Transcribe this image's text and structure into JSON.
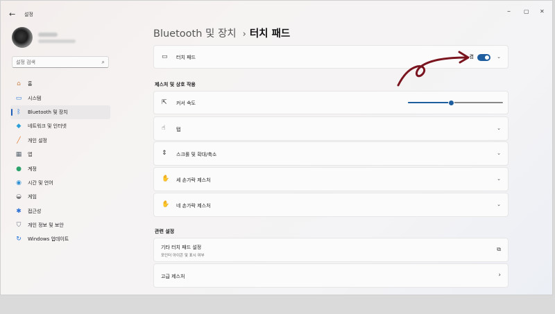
{
  "window": {
    "title": "설정",
    "back_glyph": "←",
    "minimize_glyph": "–",
    "maximize_glyph": "▢",
    "close_glyph": "✕"
  },
  "search": {
    "placeholder": "설정 검색"
  },
  "nav": {
    "items": [
      {
        "label": "홈",
        "icon": "home-icon",
        "glyph": "⌂",
        "color": "#c9864a"
      },
      {
        "label": "시스템",
        "icon": "system-icon",
        "glyph": "▭",
        "color": "#2b7cd3"
      },
      {
        "label": "Bluetooth 및 장치",
        "icon": "bluetooth-icon",
        "glyph": "ᛒ",
        "color": "#1c73d8",
        "active": true
      },
      {
        "label": "네트워크 및 인터넷",
        "icon": "wifi-icon",
        "glyph": "◆",
        "color": "#2ba0d8"
      },
      {
        "label": "개인 설정",
        "icon": "brush-icon",
        "glyph": "╱",
        "color": "#e07a2d"
      },
      {
        "label": "앱",
        "icon": "apps-icon",
        "glyph": "▦",
        "color": "#5a6772"
      },
      {
        "label": "계정",
        "icon": "account-icon",
        "glyph": "●",
        "color": "#2ba36b"
      },
      {
        "label": "시간 및 언어",
        "icon": "globe-icon",
        "glyph": "◉",
        "color": "#2b8fd3"
      },
      {
        "label": "게임",
        "icon": "gamepad-icon",
        "glyph": "◒",
        "color": "#7a7a7a"
      },
      {
        "label": "접근성",
        "icon": "accessibility-icon",
        "glyph": "✱",
        "color": "#2b6fd3"
      },
      {
        "label": "개인 정보 및 보안",
        "icon": "shield-icon",
        "glyph": "⛉",
        "color": "#6b7480"
      },
      {
        "label": "Windows 업데이트",
        "icon": "update-icon",
        "glyph": "↻",
        "color": "#1c73d8"
      }
    ]
  },
  "breadcrumb": {
    "parent": "Bluetooth 및 장치",
    "separator": "›",
    "current": "터치 패드"
  },
  "touchpad_card": {
    "label": "터치 패드",
    "icon": "touchpad-icon",
    "toggle_label": "켬",
    "toggle_on": true
  },
  "gestures": {
    "title": "제스처 및 상호 작용",
    "cursor_speed": {
      "label": "커서 속도",
      "icon": "cursor-icon",
      "value_fraction": 0.45
    },
    "items": [
      {
        "label": "탭",
        "icon": "tap-icon"
      },
      {
        "label": "스크롤 및 확대/축소",
        "icon": "scroll-icon"
      },
      {
        "label": "세 손가락 제스처",
        "icon": "three-finger-icon"
      },
      {
        "label": "네 손가락 제스처",
        "icon": "four-finger-icon"
      }
    ]
  },
  "related": {
    "title": "관련 설정",
    "more_touchpad": {
      "label": "기타 터치 패드 설정",
      "sub": "포인터 아이콘 및 표시 여부",
      "icon": "external-link-icon"
    },
    "advanced_gestures": {
      "label": "고급 제스처",
      "icon": "chevron-right-icon"
    }
  },
  "colors": {
    "accent": "#1f5e9e",
    "annotation": "#7a1520"
  }
}
